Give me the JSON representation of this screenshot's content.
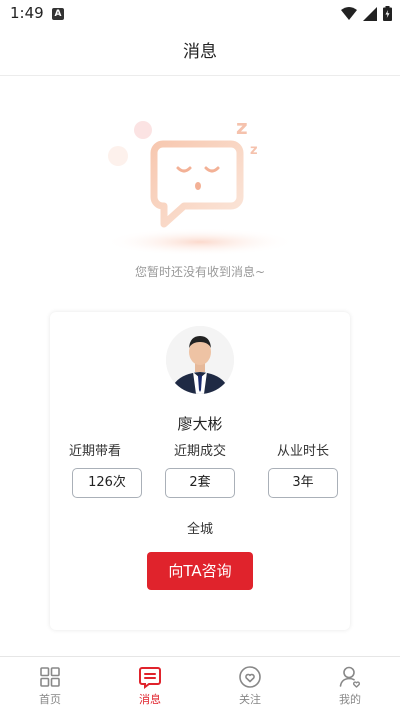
{
  "status_bar": {
    "time": "1:49",
    "notification_badge": "A",
    "icons": [
      "wifi-icon",
      "signal-icon",
      "battery-icon"
    ]
  },
  "header": {
    "title": "消息"
  },
  "empty_state": {
    "message": "您暂时还没有收到消息~",
    "illustration": "sleeping-chat-bubble",
    "sleep_symbol": "z"
  },
  "agent_card": {
    "name": "廖大彬",
    "stats": [
      {
        "label": "近期带看",
        "value": "126次"
      },
      {
        "label": "近期成交",
        "value": "2套"
      },
      {
        "label": "从业时长",
        "value": "3年"
      }
    ],
    "area": "全城",
    "consult_label": "向TA咨询"
  },
  "bottom_nav": {
    "items": [
      {
        "label": "首页",
        "icon": "grid-icon",
        "active": false
      },
      {
        "label": "消息",
        "icon": "message-icon",
        "active": true
      },
      {
        "label": "关注",
        "icon": "heart-icon",
        "active": false
      },
      {
        "label": "我的",
        "icon": "user-icon",
        "active": false
      }
    ]
  },
  "colors": {
    "accent": "#e0232c",
    "illustration": "#f6c2a4",
    "text_muted": "#999999",
    "stat_border": "#aab0b8"
  }
}
